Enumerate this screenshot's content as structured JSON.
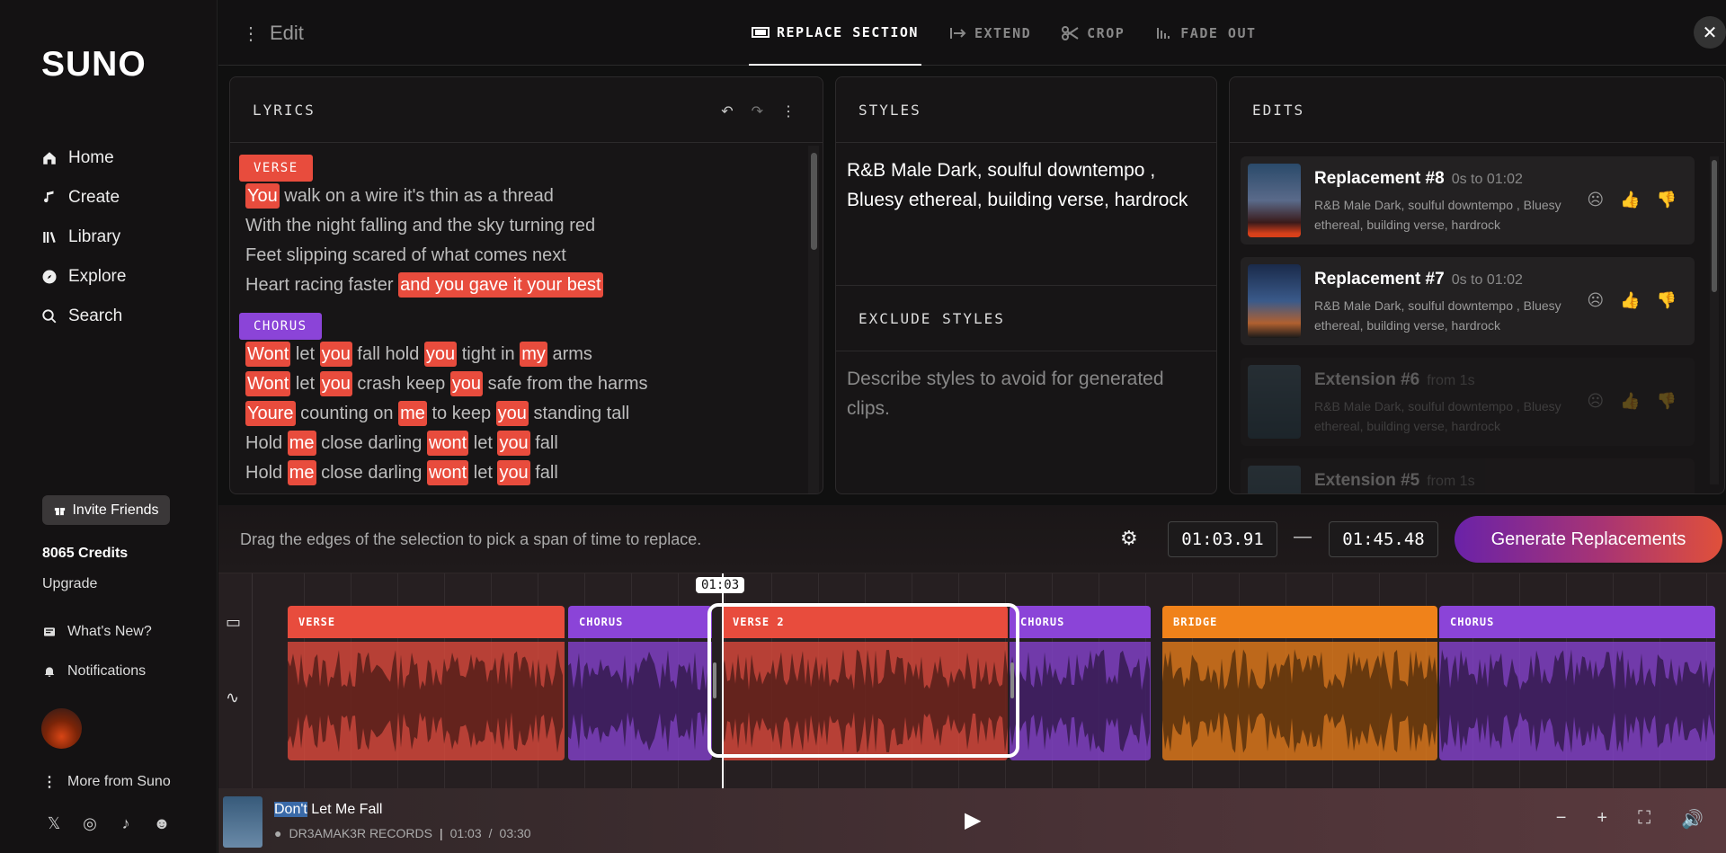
{
  "sidebar": {
    "logo": "SUNO",
    "nav": [
      {
        "label": "Home",
        "icon": "home-icon"
      },
      {
        "label": "Create",
        "icon": "music-note-icon"
      },
      {
        "label": "Library",
        "icon": "library-icon"
      },
      {
        "label": "Explore",
        "icon": "compass-icon"
      },
      {
        "label": "Search",
        "icon": "search-icon"
      }
    ],
    "invite_label": "Invite Friends",
    "credits": "8065 Credits",
    "upgrade": "Upgrade",
    "whats_new": "What's New?",
    "notifications": "Notifications",
    "more": "More from Suno"
  },
  "topbar": {
    "title": "Edit",
    "tabs": [
      "REPLACE SECTION",
      "EXTEND",
      "CROP",
      "FADE OUT"
    ],
    "active_tab": "REPLACE SECTION"
  },
  "lyrics": {
    "title": "LYRICS",
    "verse_tag": "VERSE",
    "verse_lines": [
      [
        "You",
        " walk on a wire it's thin as a thread"
      ],
      [
        "",
        "With the night falling and the sky turning red"
      ],
      [
        "",
        "Feet slipping scared of what comes next"
      ],
      [
        "Heart racing faster ",
        "and you gave it your best"
      ]
    ],
    "chorus_tag": "CHORUS",
    "chorus_lines": [
      "Wont let you fall hold you tight in my arms",
      "Wont let you crash keep you safe from the harms",
      "Youre counting on me to keep you standing tall",
      "Hold me close darling wont let you fall",
      "Hold me close darling wont let you fall"
    ]
  },
  "styles": {
    "title": "STYLES",
    "text": "R&B Male Dark, soulful  downtempo , Bluesy ethereal, building verse, hardrock",
    "exclude_title": "EXCLUDE STYLES",
    "exclude_placeholder": "Describe styles to avoid for generated clips."
  },
  "edits": {
    "title": "EDITS",
    "items": [
      {
        "name": "Replacement #8",
        "time": "0s to 01:02",
        "desc": "R&B Male Dark, soulful downtempo , Bluesy ethereal, building verse, hardrock"
      },
      {
        "name": "Replacement #7",
        "time": "0s to 01:02",
        "desc": "R&B Male Dark, soulful downtempo , Bluesy ethereal, building verse, hardrock"
      },
      {
        "name": "Extension #6",
        "time": "from 1s",
        "desc": "R&B Male Dark, soulful downtempo , Bluesy ethereal, building verse, hardrock"
      },
      {
        "name": "Extension #5",
        "time": "from 1s",
        "desc": ""
      }
    ]
  },
  "selection_bar": {
    "hint": "Drag the edges of the selection to pick a span of time to replace.",
    "start": "01:03.91",
    "dash": "—",
    "end": "01:45.48",
    "generate_label": "Generate Replacements"
  },
  "timeline": {
    "playhead": "01:03",
    "sections": [
      {
        "label": "VERSE",
        "color": "#e84c3d"
      },
      {
        "label": "CHORUS",
        "color": "#8b44d8"
      },
      {
        "label": "VERSE 2",
        "color": "#e84c3d"
      },
      {
        "label": "CHORUS",
        "color": "#8b44d8"
      },
      {
        "label": "BRIDGE",
        "color": "#f0821a"
      },
      {
        "label": "CHORUS",
        "color": "#8b44d8"
      }
    ]
  },
  "player": {
    "title_selected": "Don't",
    "title_rest": " Let Me Fall",
    "artist": "DR3AMAK3R RECORDS",
    "current": "01:03",
    "sep": "/",
    "total": "03:30"
  }
}
